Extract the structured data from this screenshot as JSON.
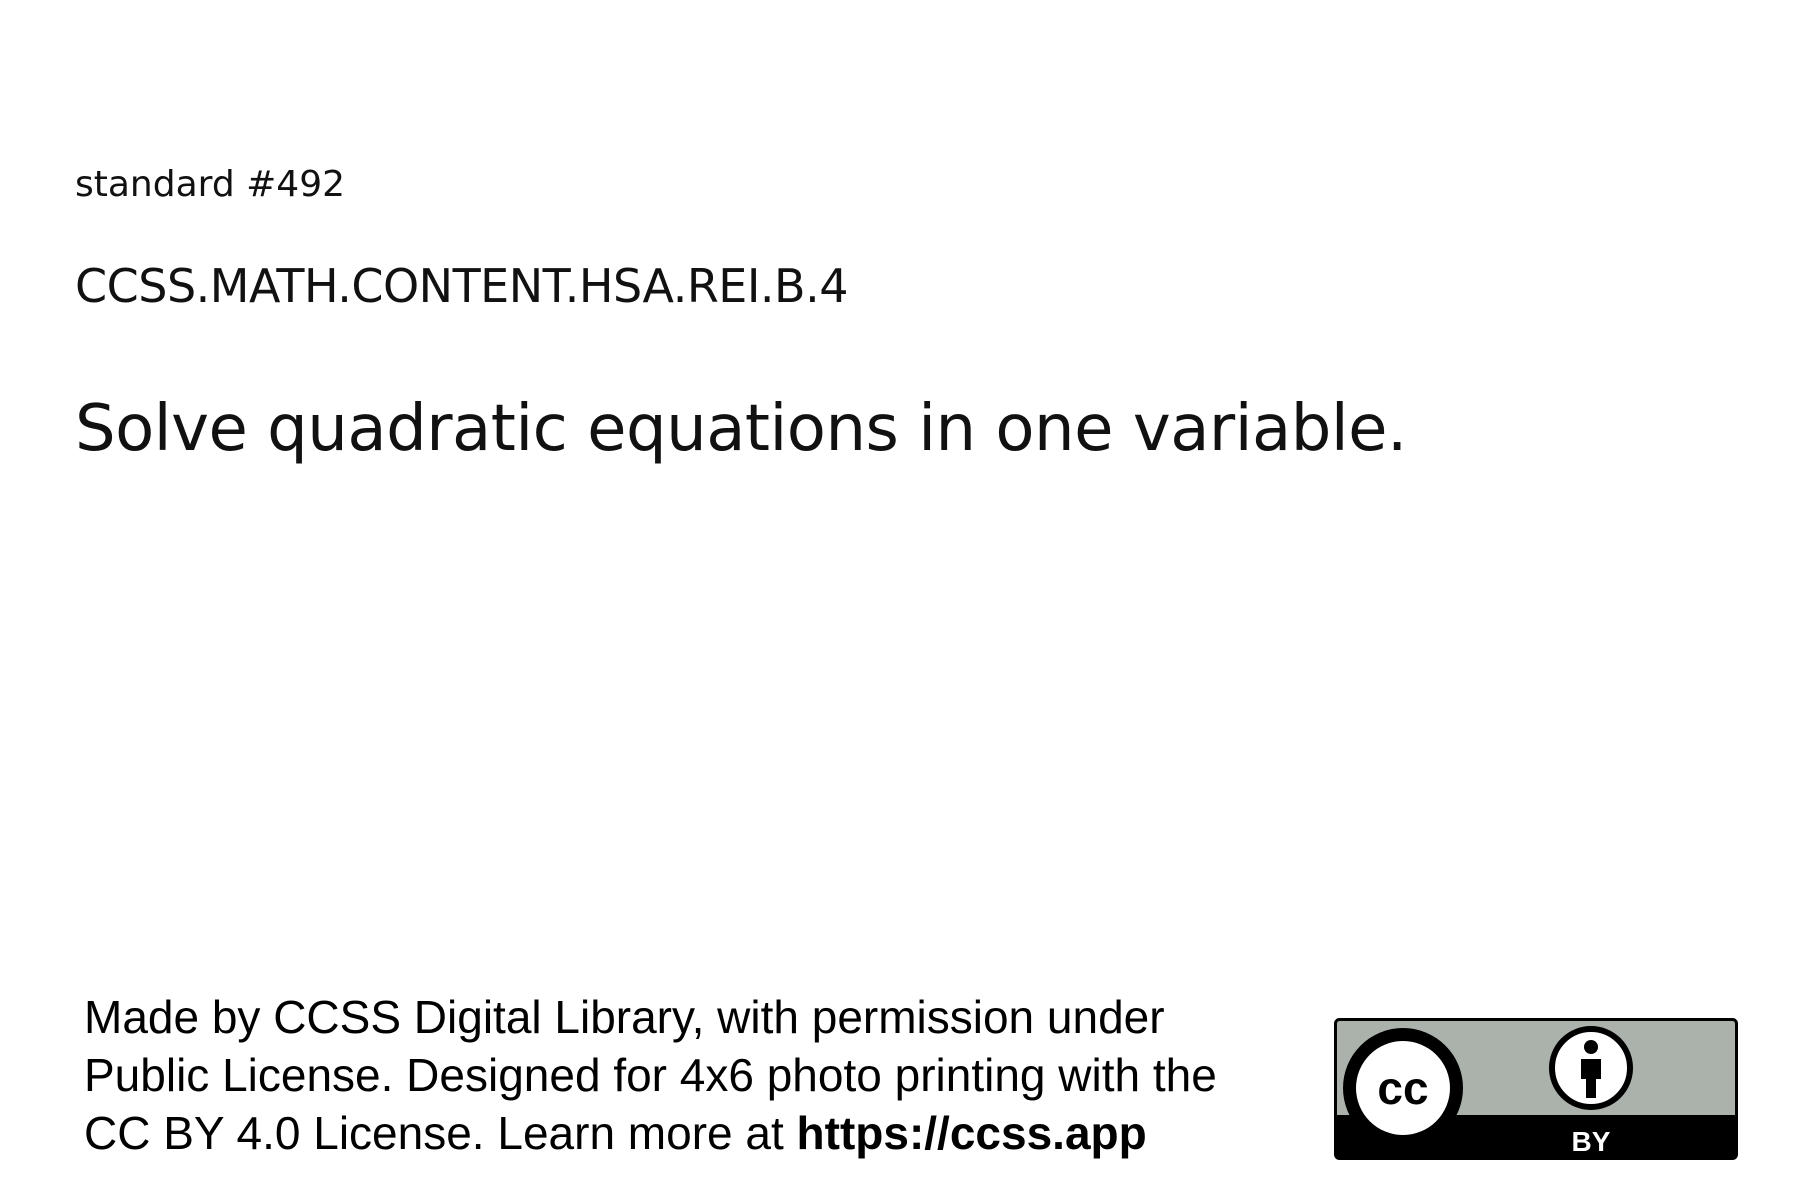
{
  "card": {
    "standard_number": "standard #492",
    "standard_code": "CCSS.MATH.CONTENT.HSA.REI.B.4",
    "description": "Solve quadratic equations in one variable."
  },
  "footer": {
    "line1": "Made by CCSS Digital Library, with permission under",
    "line2": "Public License. Designed for 4x6 photo printing with the",
    "line3_prefix": "CC BY 4.0 License. Learn more at ",
    "link_text": "https://ccss.app"
  },
  "license_badge": {
    "cc_text": "cc",
    "by_text": "BY",
    "colors": {
      "top_band": "#aab2ab",
      "bottom_band": "#000000",
      "border": "#000000",
      "text": "#ffffff"
    },
    "icons": [
      "creative-commons-icon",
      "attribution-person-icon"
    ]
  }
}
